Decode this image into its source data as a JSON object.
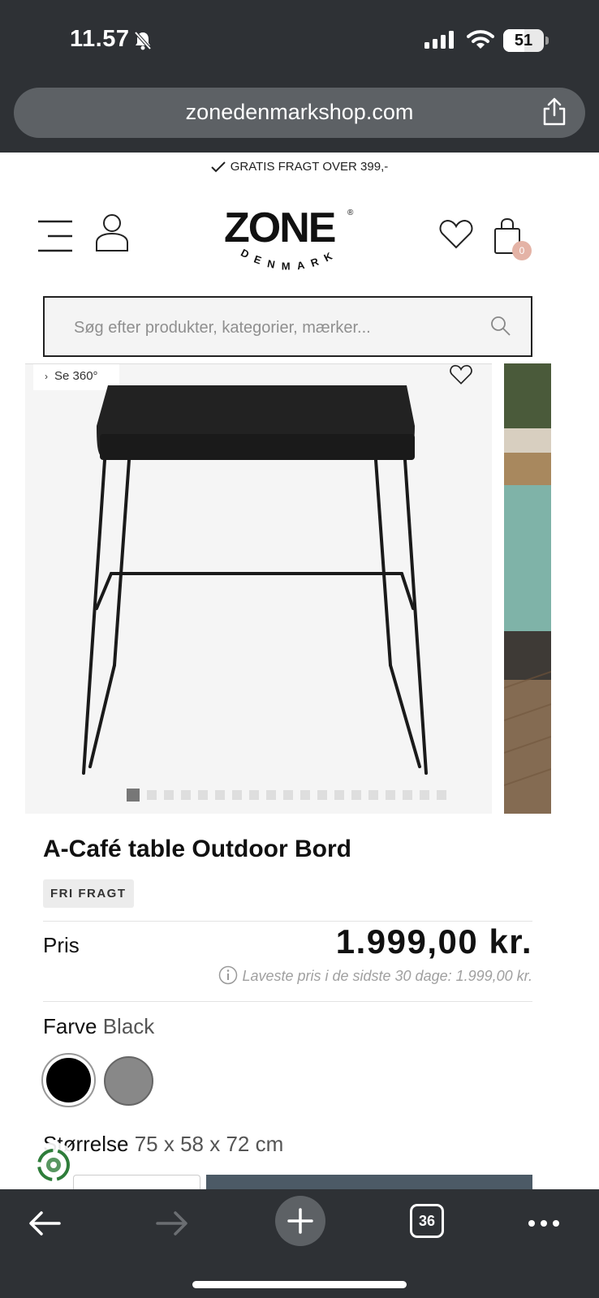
{
  "status_bar": {
    "time": "11.57",
    "battery": "51",
    "battery_level": 0.51
  },
  "browser": {
    "url": "zonedenmarkshop.com"
  },
  "promo": {
    "shipping": "GRATIS FRAGT OVER 399,-"
  },
  "header": {
    "logo": "ZONE",
    "logo_sub": "DENMARK",
    "cart_count": "0"
  },
  "search": {
    "placeholder": "Søg efter produkter, kategorier, mærker..."
  },
  "gallery": {
    "view360": "Se 360°",
    "image_count": 19,
    "active_index": 0
  },
  "product": {
    "title": "A-Café table Outdoor Bord",
    "badge": "FRI FRAGT",
    "price_label": "Pris",
    "price": "1.999,00 kr.",
    "lowest_price_note": "Laveste pris i de sidste 30 dage: 1.999,00 kr.",
    "color_label": "Farve",
    "color_value": "Black",
    "swatches": [
      {
        "name": "Black",
        "color": "#000000",
        "selected": true
      },
      {
        "name": "Grey",
        "color": "#888888",
        "selected": false
      }
    ],
    "size_label": "Størrelse",
    "size_value": "75 x 58 x 72 cm"
  },
  "bottom_nav": {
    "tabs_count": "36"
  }
}
